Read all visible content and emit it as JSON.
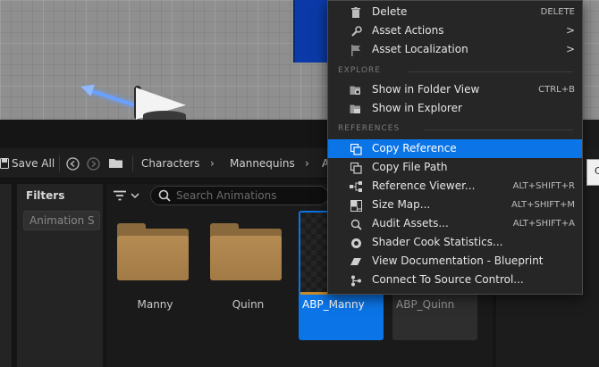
{
  "colors": {
    "accent": "#0b74e6",
    "menu_bg": "#262626",
    "folder": "#a27a45"
  },
  "toolbar": {
    "save_all_label": "Save All",
    "breadcrumb": [
      "Characters",
      "Mannequins",
      "A"
    ],
    "filters_title": "Filters",
    "filter_chip": "Animation S",
    "search_placeholder": "Search Animations"
  },
  "assets": [
    {
      "label": "Manny",
      "kind": "folder",
      "selected": false
    },
    {
      "label": "Quinn",
      "kind": "folder",
      "selected": false
    },
    {
      "label": "ABP_Manny",
      "kind": "blueprint",
      "selected": true
    },
    {
      "label": "ABP_Quinn",
      "kind": "blueprint",
      "selected": false
    }
  ],
  "context_menu": {
    "items_top": [
      {
        "label": "Delete",
        "shortcut": "DELETE",
        "icon": "trash-icon"
      },
      {
        "label": "Asset Actions",
        "submenu": ">",
        "icon": "wrench-icon"
      },
      {
        "label": "Asset Localization",
        "submenu": ">",
        "icon": "flag-icon"
      }
    ],
    "explore_header": "EXPLORE",
    "explore_items": [
      {
        "label": "Show in Folder View",
        "shortcut": "CTRL+B",
        "icon": "folder-search-icon"
      },
      {
        "label": "Show in Explorer",
        "icon": "folder-icon"
      }
    ],
    "references_header": "REFERENCES",
    "reference_items": [
      {
        "label": "Copy Reference",
        "icon": "copy-icon",
        "highlighted": true
      },
      {
        "label": "Copy File Path",
        "icon": "copy-path-icon"
      },
      {
        "label": "Reference Viewer...",
        "shortcut": "ALT+SHIFT+R",
        "icon": "reference-viewer-icon"
      },
      {
        "label": "Size Map...",
        "shortcut": "ALT+SHIFT+M",
        "icon": "size-map-icon"
      },
      {
        "label": "Audit Assets...",
        "shortcut": "ALT+SHIFT+A",
        "icon": "audit-icon"
      },
      {
        "label": "Shader Cook Statistics...",
        "icon": "shader-stats-icon"
      },
      {
        "label": "View Documentation - Blueprint",
        "icon": "documentation-icon"
      },
      {
        "label": "Connect To Source Control...",
        "icon": "source-control-icon"
      }
    ]
  },
  "tooltip_text": "C"
}
